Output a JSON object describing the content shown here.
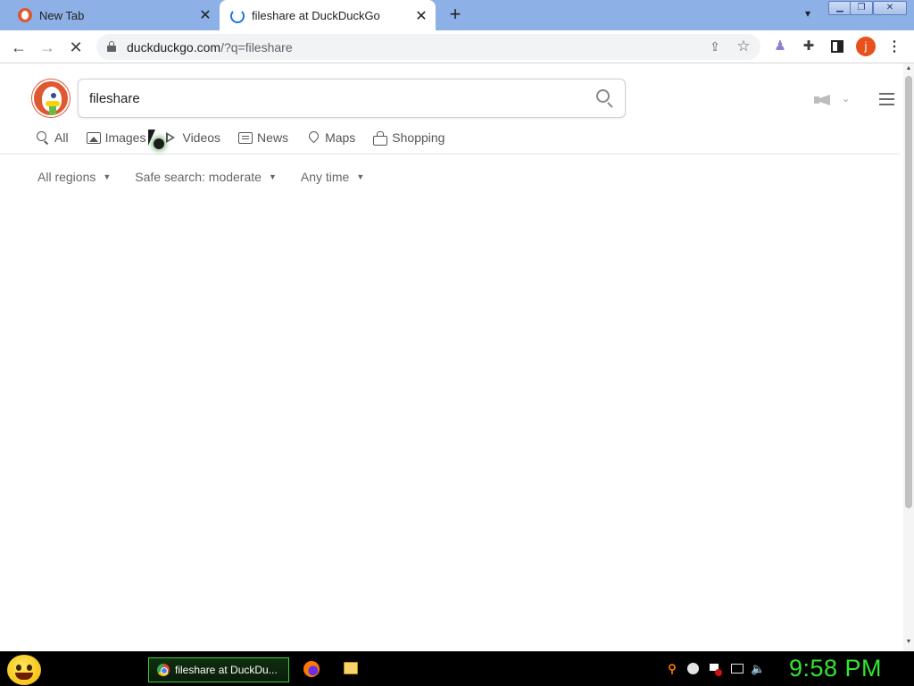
{
  "browser": {
    "tabs": [
      {
        "title": "New Tab",
        "active": false
      },
      {
        "title": "fileshare at DuckDuckGo",
        "active": true
      }
    ],
    "new_tab": "+",
    "window_controls": {
      "minimize": "▁",
      "maximize": "❐",
      "close": "✕"
    },
    "url_host": "duckduckgo.com",
    "url_rest": "/?q=fileshare",
    "avatar_letter": "j",
    "icons": {
      "back": "arrow-left-icon",
      "forward": "arrow-right-icon",
      "stop": "close-icon",
      "share": "share-icon",
      "star": "star-icon",
      "extensions": "puzzle-icon",
      "menu": "kebab-icon"
    }
  },
  "search": {
    "query": "fileshare",
    "nav": [
      {
        "label": "All",
        "icon": "search-icon"
      },
      {
        "label": "Images",
        "icon": "image-icon"
      },
      {
        "label": "Videos",
        "icon": "play-icon"
      },
      {
        "label": "News",
        "icon": "newspaper-icon"
      },
      {
        "label": "Maps",
        "icon": "map-pin-icon"
      },
      {
        "label": "Shopping",
        "icon": "shopping-bag-icon"
      }
    ],
    "filters": [
      {
        "label": "All regions"
      },
      {
        "label": "Safe search: moderate"
      },
      {
        "label": "Any time"
      }
    ]
  },
  "taskbar": {
    "window_label": "fileshare at DuckDu...",
    "clock": "9:58 PM",
    "accent": "#32e532"
  },
  "colors": {
    "tabstrip": "#8db0e6",
    "ddg_orange": "#de5833",
    "loading_blue": "#1a73e8"
  }
}
